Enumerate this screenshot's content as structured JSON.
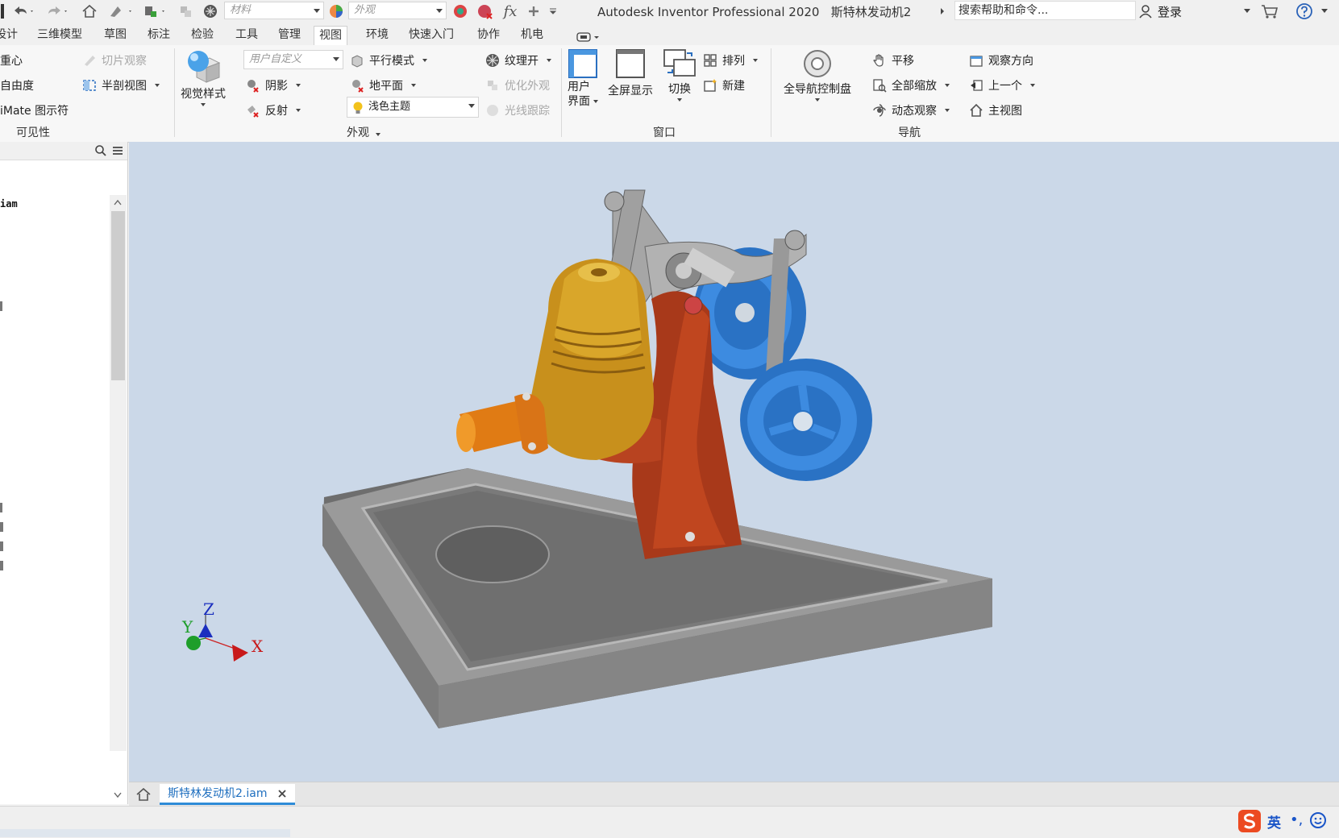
{
  "titlebar": {
    "app_title": "Autodesk Inventor Professional 2020",
    "doc_title": "斯特林发动机2",
    "material_placeholder": "材料",
    "appearance_placeholder": "外观",
    "search_text": "搜索帮助和命令...",
    "login_label": "登录",
    "fx_label": "fx"
  },
  "tabs": [
    "设计",
    "三维模型",
    "草图",
    "标注",
    "检验",
    "工具",
    "管理",
    "视图",
    "环境",
    "快速入门",
    "协作",
    "机电"
  ],
  "active_tab": "视图",
  "ribbon": {
    "visibility": {
      "items": [
        "重心",
        "自由度",
        "iMate 图示符"
      ],
      "slice_label": "切片观察",
      "half_section_label": "半剖视图",
      "group_label": "可见性"
    },
    "appearance": {
      "visual_style_label": "视觉样式",
      "custom_combo": "用户自定义",
      "shadow_label": "阴影",
      "reflection_label": "反射",
      "parallel_mode_label": "平行模式",
      "ground_plane_label": "地平面",
      "theme_combo": "浅色主题",
      "texture_label": "纹理开",
      "optimize_label": "优化外观",
      "raytrace_label": "光线跟踪",
      "group_label": "外观"
    },
    "window": {
      "user_interface_label_1": "用户",
      "user_interface_label_2": "界面",
      "fullscreen_label": "全屏显示",
      "switch_label": "切换",
      "arrange_label": "排列",
      "new_label": "新建",
      "group_label": "窗口"
    },
    "navigation": {
      "steering_wheel_label": "全导航控制盘",
      "pan_label": "平移",
      "zoom_all_label": "全部缩放",
      "orbit_label": "动态观察",
      "view_face_label": "观察方向",
      "previous_label": "上一个",
      "home_label": "主视图",
      "group_label": "导航"
    }
  },
  "browser": {
    "root_label": "iam"
  },
  "viewcube": {
    "x": "X",
    "y": "Y",
    "z": "Z"
  },
  "doc_tab": {
    "label": "斯特林发动机2.iam"
  },
  "ime": {
    "lang": "英"
  },
  "colors": {
    "viewport_bg": "#cbd8e8",
    "base_plate": "#8a8a8a",
    "cylinder_gold": "#c8901c",
    "frame_red": "#b23b18",
    "flywheel_blue": "#2e7fd6",
    "accent_tab": "#2e8bd7"
  }
}
